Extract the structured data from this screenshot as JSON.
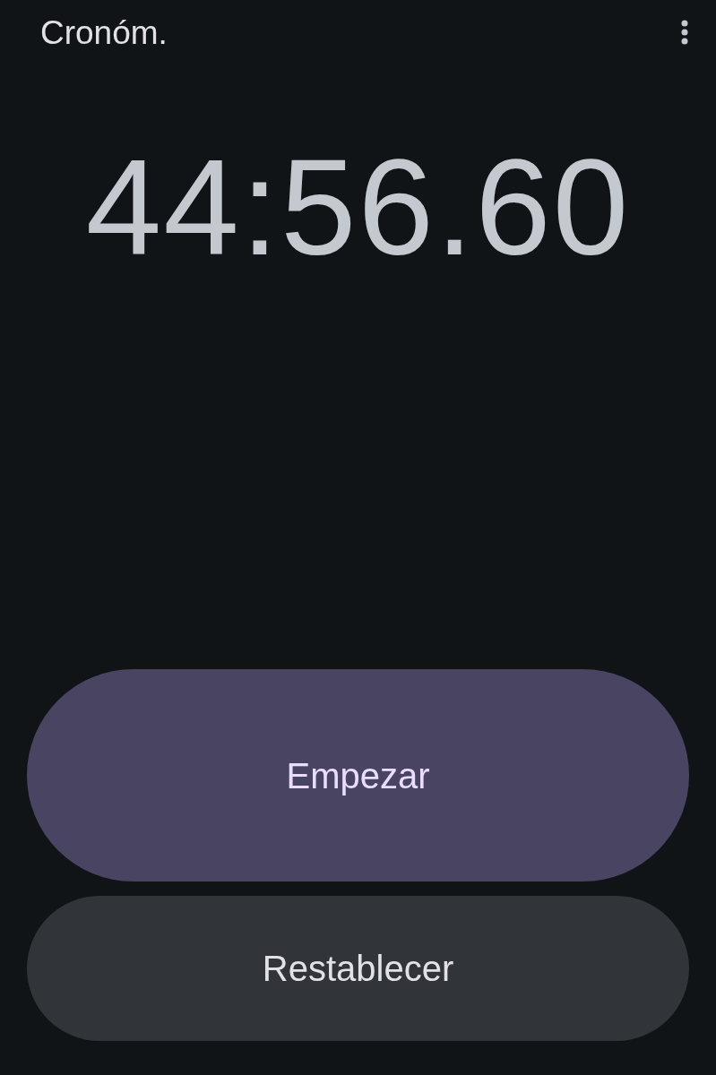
{
  "app_bar": {
    "title": "Cronóm."
  },
  "time": "44:56.60",
  "buttons": [
    {
      "label": "Empezar",
      "kind": "primary"
    },
    {
      "label": "Restablecer",
      "kind": "secondary"
    }
  ]
}
